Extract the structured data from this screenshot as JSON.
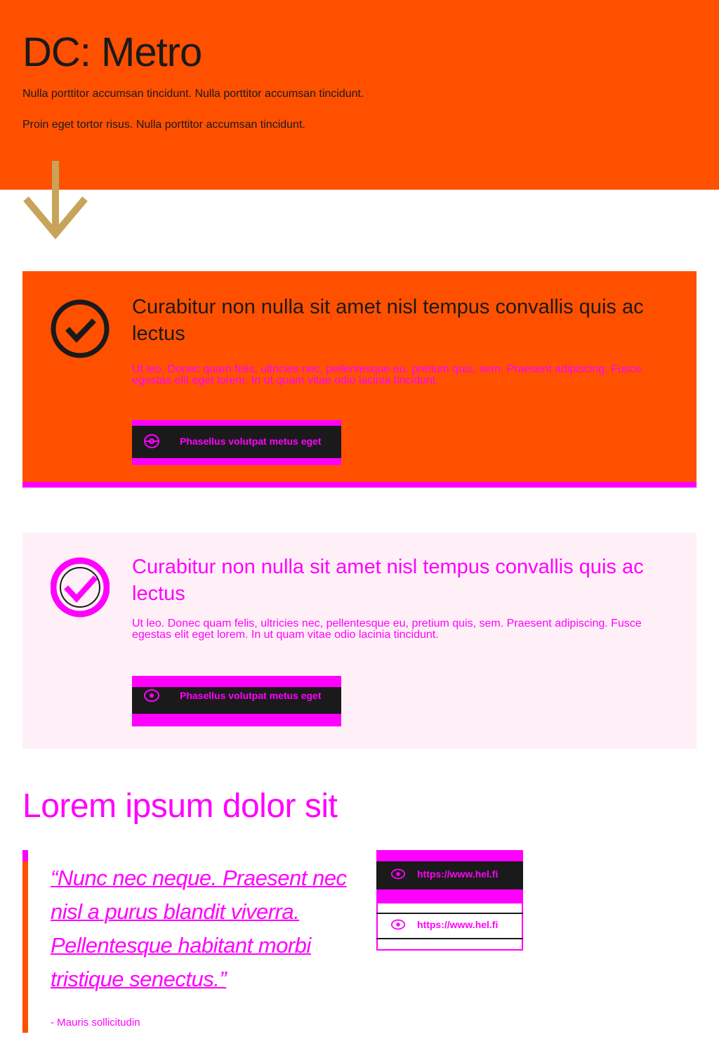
{
  "hero": {
    "title": "DC: Metro",
    "paragraph_1": "Nulla porttitor accumsan tincidunt. Nulla porttitor accumsan tincidunt.",
    "paragraph_2": "Proin eget tortor risus. Nulla porttitor accumsan tincidunt."
  },
  "card_primary": {
    "title": "Curabitur non nulla sit amet nisl tempus convallis quis ac lectus",
    "text": "Ut leo. Donec quam felis, ultricies nec, pellentesque eu, pretium quis, sem. Praesent adipiscing. Fusce egestas elit eget lorem. In ut quam vitae odio lacinia tincidunt.",
    "link_label": "Phasellus volutpat metus eget"
  },
  "card_secondary": {
    "title": "Curabitur non nulla sit amet nisl tempus convallis quis ac lectus",
    "text": "Ut leo. Donec quam felis, ultricies nec, pellentesque eu, pretium quis, sem. Praesent adipiscing. Fusce egestas elit eget lorem. In ut quam vitae odio lacinia tincidunt.",
    "link_label": "Phasellus volutpat metus eget"
  },
  "section": {
    "title": "Lorem ipsum dolor sit"
  },
  "quote": {
    "text": "“Nunc nec neque. Praesent nec nisl a purus blandit viverra. Pellentesque habitant morbi tristique senectus.”",
    "author": "- Mauris sollicitudin"
  },
  "links": {
    "url": "https://www.hel.fi"
  },
  "colors": {
    "brand_orange": "#ff5000",
    "accent_magenta": "#ff00ff",
    "arrow_gold": "#c8a45a",
    "dark": "#1a1a1a",
    "light_pink": "#fff0f8"
  },
  "icons": {
    "arrow": "arrow-down-icon",
    "check": "check-circle-icon",
    "link": "eye-icon"
  }
}
